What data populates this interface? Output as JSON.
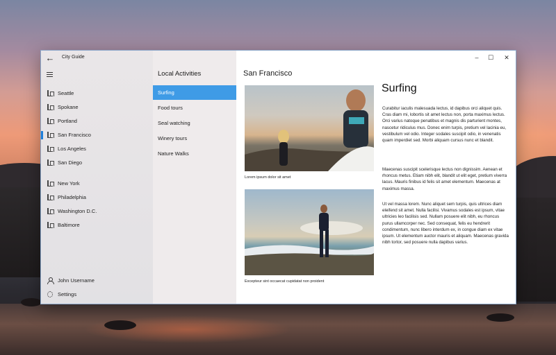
{
  "window": {
    "app_title": "City Guide",
    "back_icon": "back-arrow-icon",
    "controls": {
      "minimize": "–",
      "maximize": "☐",
      "close": "✕"
    }
  },
  "nav": {
    "menu_icon": "hamburger-icon",
    "cities_group1": [
      {
        "label": "Seattle",
        "icon": "city-icon"
      },
      {
        "label": "Spokane",
        "icon": "city-icon"
      },
      {
        "label": "Portland",
        "icon": "city-icon"
      },
      {
        "label": "San Francisco",
        "icon": "city-icon",
        "selected": true
      },
      {
        "label": "Los Angeles",
        "icon": "city-icon"
      },
      {
        "label": "San Diego",
        "icon": "city-icon"
      }
    ],
    "cities_group2": [
      {
        "label": "New York",
        "icon": "city-icon"
      },
      {
        "label": "Philadelphia",
        "icon": "city-icon"
      },
      {
        "label": "Washington D.C.",
        "icon": "city-icon"
      },
      {
        "label": "Baltimore",
        "icon": "city-icon"
      }
    ],
    "user": {
      "label": "John Username",
      "icon": "person-icon"
    },
    "settings": {
      "label": "Settings",
      "icon": "gear-icon"
    },
    "accent_color": "#1e7fd9"
  },
  "activities": {
    "heading": "Local Activities",
    "items": [
      {
        "label": "Surfing",
        "selected": true
      },
      {
        "label": "Food tours"
      },
      {
        "label": "Seal watching"
      },
      {
        "label": "Winery tours"
      },
      {
        "label": "Nature Walks"
      }
    ],
    "selected_color": "#3f9be6"
  },
  "content": {
    "city_title": "San Francisco",
    "activity_title": "Surfing",
    "photo1_caption": "Lorem ipsum dolor sit amet",
    "photo2_caption": "Excepteur sint occaecat cupidatat non proident",
    "paragraphs": [
      "Curabitur iaculis malesuada lectus, id dapibus orci aliquet quis. Cras diam mi, lobortis sit amet lectus non, porta maximus lectus. Orci varius natoque penatibus et magnis dis parturient montes, nascetur ridiculus mus. Donec enim turpis, pretium vel lacinia eu, vestibulum vel odio. Integer sodales suscipit odio, in venenatis quam imperdiet sed. Morbi aliquam cursus nunc et blandit.",
      "Maecenas suscipit scelerisque lectus non dignissim. Aenean et rhoncus metus. Etiam nibh elit, blandit ut elit eget, pretium viverra lacus. Mauris finibus id felis sit amet elementum. Maecenas at maximus massa.",
      "Ut vel massa lorem. Nunc aliquet sem turpis, quis ultrices diam eleifend sit amet. Nulla facilisi. Vivamus sodales est ipsum, vitae ultricies leo facilisis sed. Nullam posuere elit nibh, eu rhoncus purus ullamcorper nec. Sed consequat, felis eu hendrerit condimentum, nunc libero interdum ex, in congue diam ex vitae ipsum. Ut elementum auctor mauris et aliquam. Maecenas gravida nibh tortor, sed posuere nulla dapibus varius."
    ]
  }
}
